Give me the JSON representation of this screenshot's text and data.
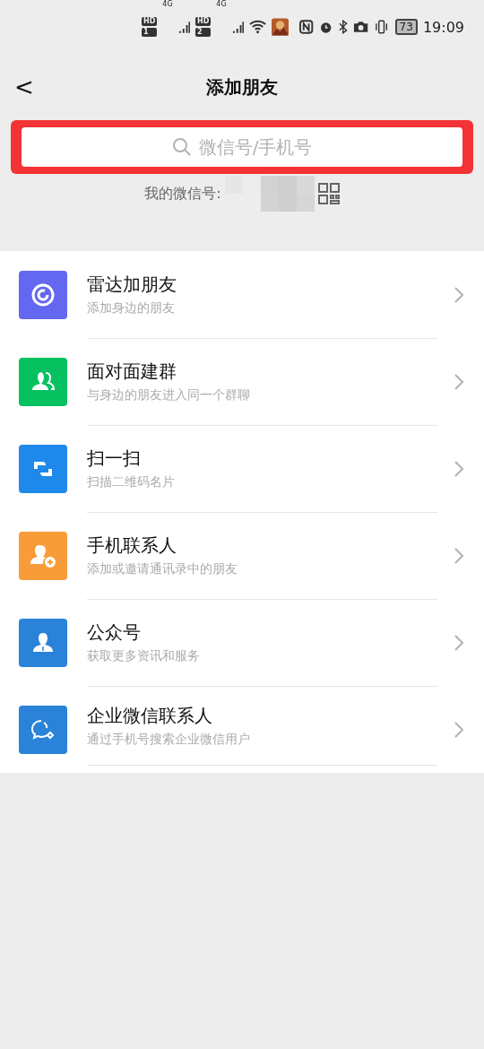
{
  "status_bar": {
    "sims": [
      {
        "hd": "HD",
        "slot": "1",
        "network": "4G"
      },
      {
        "hd": "HD",
        "slot": "2",
        "network": "4G"
      }
    ],
    "battery": "73",
    "time": "19:09"
  },
  "header": {
    "back": "<",
    "title": "添加朋友"
  },
  "search": {
    "placeholder": "微信号/手机号",
    "highlighted": true
  },
  "my_id": {
    "label": "我的微信号:"
  },
  "items": [
    {
      "kind": "radar",
      "title": "雷达加朋友",
      "subtitle": "添加身边的朋友",
      "color": "#6467f0"
    },
    {
      "kind": "group",
      "title": "面对面建群",
      "subtitle": "与身边的朋友进入同一个群聊",
      "color": "#07c160"
    },
    {
      "kind": "scan",
      "title": "扫一扫",
      "subtitle": "扫描二维码名片",
      "color": "#1f88eb"
    },
    {
      "kind": "contact",
      "title": "手机联系人",
      "subtitle": "添加或邀请通讯录中的朋友",
      "color": "#f79c38"
    },
    {
      "kind": "official",
      "title": "公众号",
      "subtitle": "获取更多资讯和服务",
      "color": "#2b82d9"
    },
    {
      "kind": "work",
      "title": "企业微信联系人",
      "subtitle": "通过手机号搜索企业微信用户",
      "color": "#2b82d9"
    }
  ]
}
